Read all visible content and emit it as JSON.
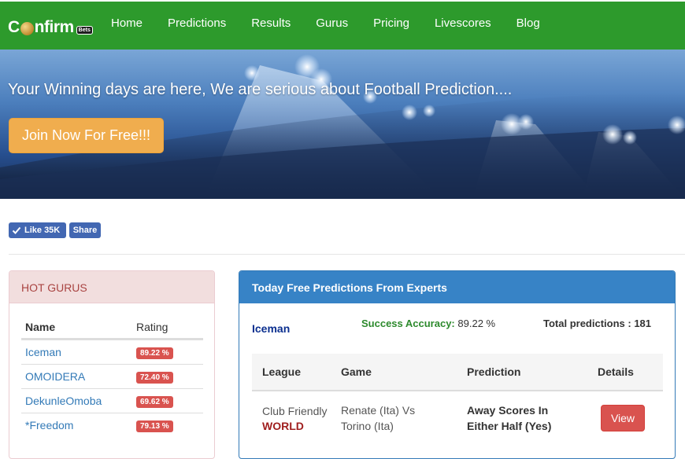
{
  "navbar": {
    "brand_prefix": "C",
    "brand_suffix": "nfirm",
    "brand_tag": "Bets",
    "links": [
      "Home",
      "Predictions",
      "Results",
      "Gurus",
      "Pricing",
      "Livescores",
      "Blog"
    ],
    "color": "#2d9a2c"
  },
  "hero": {
    "title": "Your Winning days are here, We are serious about Football Prediction....",
    "cta": "Join Now For Free!!!",
    "cta_color": "#f0ad4e"
  },
  "social": {
    "like_label": "Like 35K",
    "share_label": "Share"
  },
  "hot_gurus": {
    "title": "HOT GURUS",
    "col_name": "Name",
    "col_rating": "Rating",
    "rows": [
      {
        "name": "Iceman",
        "rating": "89.22 %"
      },
      {
        "name": "OMOIDERA",
        "rating": "72.40 %"
      },
      {
        "name": "DekunleOmoba",
        "rating": "69.62 %"
      },
      {
        "name": "*Freedom",
        "rating": "79.13 %"
      }
    ]
  },
  "predictions": {
    "title": "Today Free Predictions From Experts",
    "guru": "Iceman",
    "accuracy_label": "Success Accuracy:",
    "accuracy_value": "89.22 %",
    "total_label": "Total predictions : 181",
    "columns": [
      "League",
      "Game",
      "Prediction",
      "Details"
    ],
    "rows": [
      {
        "league": "Club Friendly",
        "region": "WORLD",
        "game_line1": "Renate (Ita) Vs",
        "game_line2": "Torino (Ita)",
        "prediction_line1": "Away Scores In",
        "prediction_line2": "Either Half (Yes)",
        "action": "View"
      }
    ]
  }
}
